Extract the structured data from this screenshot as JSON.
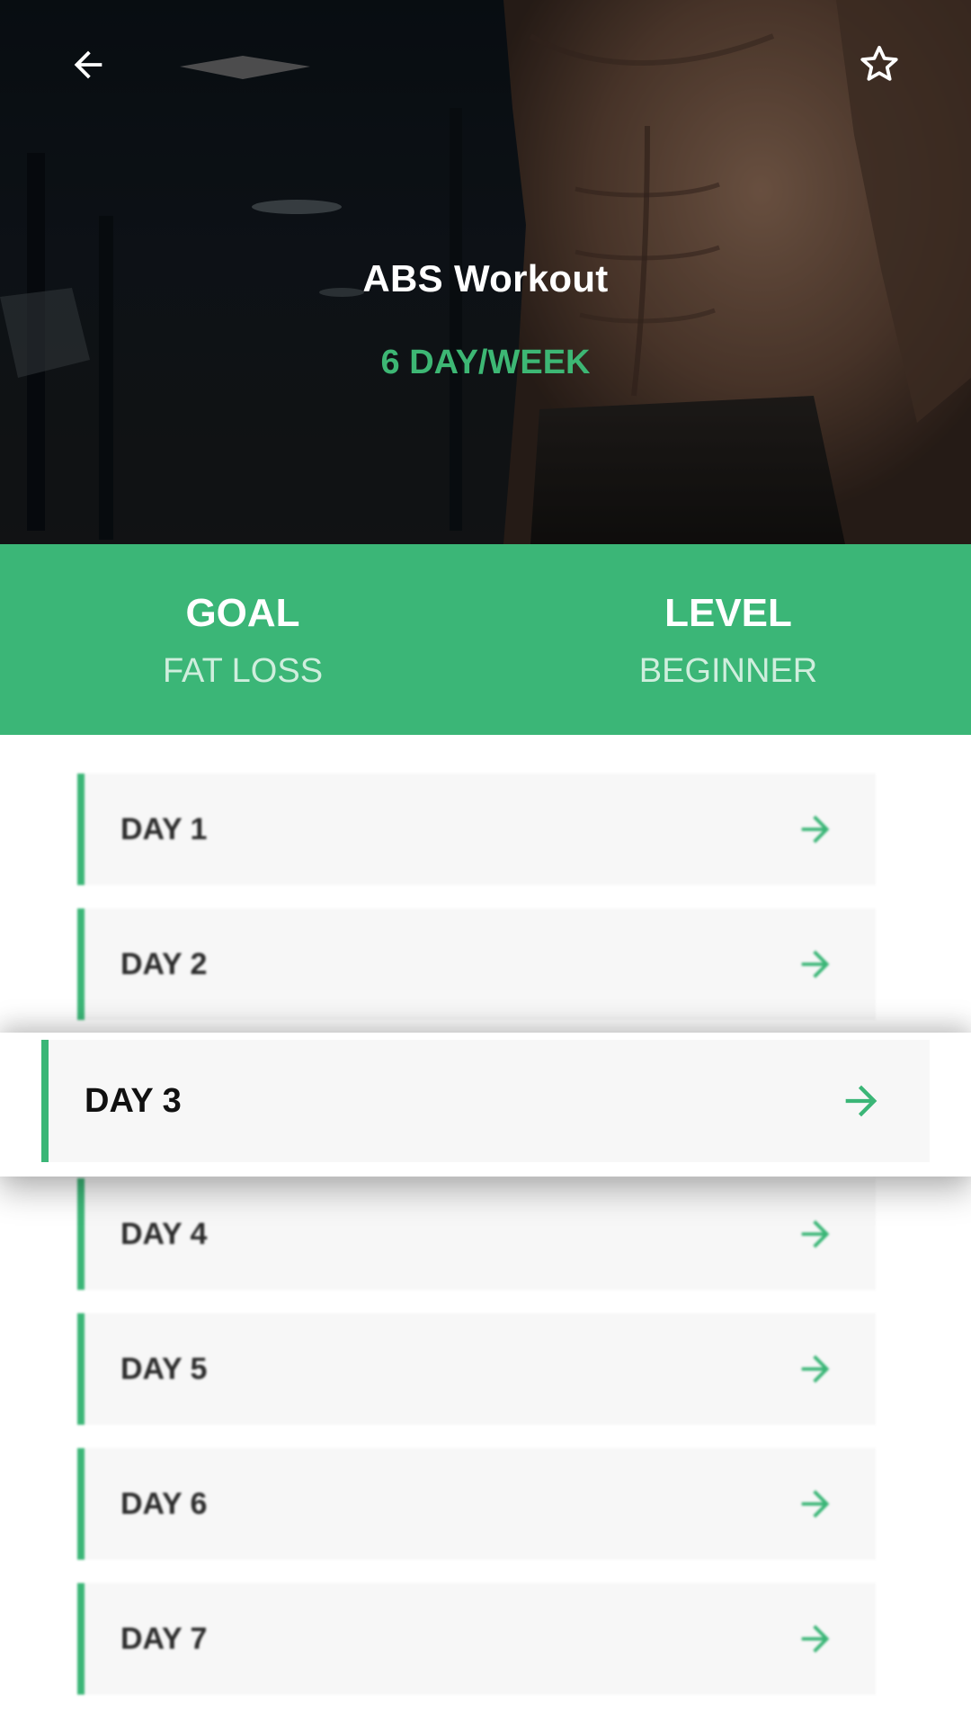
{
  "header": {
    "back_icon": "arrow-left-icon",
    "favorite_icon": "star-outline-icon"
  },
  "hero": {
    "title": "ABS Workout",
    "subtitle": "6 DAY/WEEK"
  },
  "stats": [
    {
      "label": "GOAL",
      "value": "FAT LOSS"
    },
    {
      "label": "LEVEL",
      "value": "BEGINNER"
    }
  ],
  "days": [
    {
      "label": "DAY 1"
    },
    {
      "label": "DAY 2"
    },
    {
      "label": "DAY 3"
    },
    {
      "label": "DAY 4"
    },
    {
      "label": "DAY 5"
    },
    {
      "label": "DAY 6"
    },
    {
      "label": "DAY 7"
    }
  ],
  "highlighted_day": "DAY 3",
  "colors": {
    "accent": "#3bb677",
    "card_bg": "#f7f7f7",
    "hero_dark": "#141b22"
  }
}
